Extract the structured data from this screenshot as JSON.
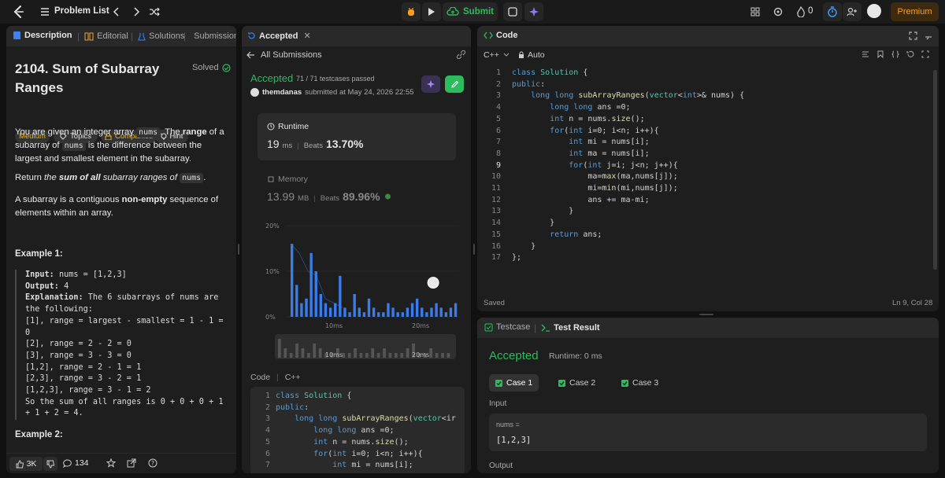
{
  "topbar": {
    "problem_list": "Problem List",
    "submit": "Submit",
    "fire_count": "0",
    "premium": "Premium"
  },
  "left": {
    "tabs": {
      "description": "Description",
      "editorial": "Editorial",
      "solutions": "Solutions",
      "submissions": "Submissions"
    },
    "title_line1": "2104. Sum of Subarray",
    "title_line2": "Ranges",
    "solved": "Solved",
    "tags": {
      "difficulty": "Medium",
      "topics": "Topics",
      "companies": "Companies",
      "hint": "Hint"
    },
    "para1": {
      "a": "You are given an integer array ",
      "code1": "nums",
      "b": ". The ",
      "range": "range",
      "c": " of a subarray of ",
      "code2": "nums",
      "d": " is the difference between the largest and smallest element in the subarray."
    },
    "para2": {
      "a": "Return ",
      "b": "the ",
      "sum": "sum of all",
      "c": " subarray ranges of ",
      "code": "nums",
      "d": "."
    },
    "para3": {
      "a": "A subarray is a contiguous ",
      "b": "non-empty",
      "c": " sequence of elements within an array."
    },
    "example1_title": "Example 1:",
    "example1": {
      "input_label": "Input:",
      "input": " nums = [1,2,3]",
      "output_label": "Output:",
      "output": " 4",
      "expl_label": "Explanation:",
      "expl": " The 6 subarrays of nums are the following:\n[1], range = largest - smallest = 1 - 1 = 0\n[2], range = 2 - 2 = 0\n[3], range = 3 - 3 = 0\n[1,2], range = 2 - 1 = 1\n[2,3], range = 3 - 2 = 1\n[1,2,3], range = 3 - 1 = 2\nSo the sum of all ranges is 0 + 0 + 0 + 1 + 1 + 2 = 4."
    },
    "example2_title": "Example 2:",
    "likes": "3K",
    "comments": "134"
  },
  "mid": {
    "tab": "Accepted",
    "all_submissions": "All Submissions",
    "status": "Accepted",
    "testcases": "71 / 71 testcases passed",
    "user": "themdanas",
    "submitted": "submitted at May 24, 2026 22:55",
    "runtime_label": "Runtime",
    "runtime_value": "19",
    "runtime_unit": "ms",
    "beats_label": "Beats",
    "runtime_beats": "13.70%",
    "memory_label": "Memory",
    "memory_value": "13.99",
    "memory_unit": "MB",
    "memory_beats": "89.96%",
    "code_label": "Code",
    "code_lang": "C++"
  },
  "chart_data": {
    "type": "bar",
    "ylabel_ticks": [
      "20%",
      "10%",
      "0%"
    ],
    "ylim": [
      0,
      20
    ],
    "x_ticks": [
      "10ms",
      "20ms"
    ],
    "values": [
      16,
      7,
      3,
      4,
      14,
      10,
      5,
      3,
      2,
      3,
      9,
      2,
      1,
      5,
      2,
      1,
      4,
      2,
      1,
      1,
      3,
      2,
      1,
      1,
      2,
      3,
      4,
      2,
      1,
      2,
      3,
      2,
      1,
      2,
      3
    ],
    "highlight_index": 30,
    "line_values": [
      16,
      14,
      10,
      9,
      4,
      3,
      2
    ],
    "mini_values": [
      4,
      2,
      1,
      3,
      2,
      1,
      3,
      2,
      1,
      1,
      2,
      1,
      1,
      2,
      1,
      1,
      2,
      1,
      2,
      1,
      1,
      1,
      2,
      3,
      1,
      1,
      2,
      1,
      1,
      1
    ]
  },
  "right": {
    "code_tab": "Code",
    "lang": "C++",
    "auto": "Auto",
    "saved": "Saved",
    "cursor": "Ln 9, Col 28",
    "testcase_tab": "Testcase",
    "result_tab": "Test Result",
    "result_status": "Accepted",
    "result_runtime": "Runtime: 0 ms",
    "cases": [
      "Case 1",
      "Case 2",
      "Case 3"
    ],
    "input_label": "Input",
    "input_var": "nums =",
    "input_value": "[1,2,3]",
    "output_label": "Output"
  },
  "code": {
    "lines": [
      "class Solution {",
      "public:",
      "    long long subArrayRanges(vector<int>& nums) {",
      "        long long ans =0;",
      "        int n = nums.size();",
      "        for(int i=0; i<n; i++){",
      "            int mi = nums[i];",
      "            int ma = nums[i];",
      "            for(int j=i; j<n; j++){",
      "                ma=max(ma,nums[j]);",
      "                mi=min(mi,nums[j]);",
      "                ans += ma-mi;",
      "            }",
      "        }",
      "        return ans;",
      "    }",
      "};"
    ],
    "mid_lines": [
      "class Solution {",
      "public:",
      "    long long subArrayRanges(vector<ir",
      "        long long ans =0;",
      "        int n = nums.size();",
      "        for(int i=0; i<n; i++){",
      "            int mi = nums[i];"
    ]
  },
  "colors": {
    "accent_green": "#2cbb5d",
    "medium": "#ffb800",
    "bar_blue": "#3b82f6",
    "premium": "#ffa116"
  }
}
